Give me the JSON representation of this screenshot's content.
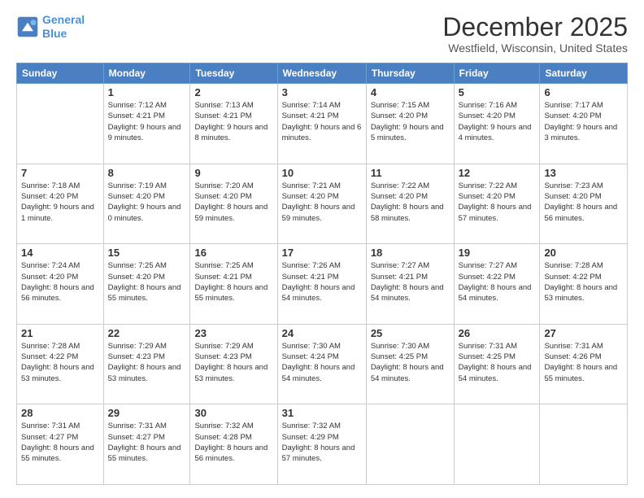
{
  "logo": {
    "line1": "General",
    "line2": "Blue"
  },
  "title": "December 2025",
  "subtitle": "Westfield, Wisconsin, United States",
  "days_header": [
    "Sunday",
    "Monday",
    "Tuesday",
    "Wednesday",
    "Thursday",
    "Friday",
    "Saturday"
  ],
  "weeks": [
    [
      {
        "num": "",
        "info": ""
      },
      {
        "num": "1",
        "info": "Sunrise: 7:12 AM\nSunset: 4:21 PM\nDaylight: 9 hours\nand 9 minutes."
      },
      {
        "num": "2",
        "info": "Sunrise: 7:13 AM\nSunset: 4:21 PM\nDaylight: 9 hours\nand 8 minutes."
      },
      {
        "num": "3",
        "info": "Sunrise: 7:14 AM\nSunset: 4:21 PM\nDaylight: 9 hours\nand 6 minutes."
      },
      {
        "num": "4",
        "info": "Sunrise: 7:15 AM\nSunset: 4:20 PM\nDaylight: 9 hours\nand 5 minutes."
      },
      {
        "num": "5",
        "info": "Sunrise: 7:16 AM\nSunset: 4:20 PM\nDaylight: 9 hours\nand 4 minutes."
      },
      {
        "num": "6",
        "info": "Sunrise: 7:17 AM\nSunset: 4:20 PM\nDaylight: 9 hours\nand 3 minutes."
      }
    ],
    [
      {
        "num": "7",
        "info": "Sunrise: 7:18 AM\nSunset: 4:20 PM\nDaylight: 9 hours\nand 1 minute."
      },
      {
        "num": "8",
        "info": "Sunrise: 7:19 AM\nSunset: 4:20 PM\nDaylight: 9 hours\nand 0 minutes."
      },
      {
        "num": "9",
        "info": "Sunrise: 7:20 AM\nSunset: 4:20 PM\nDaylight: 8 hours\nand 59 minutes."
      },
      {
        "num": "10",
        "info": "Sunrise: 7:21 AM\nSunset: 4:20 PM\nDaylight: 8 hours\nand 59 minutes."
      },
      {
        "num": "11",
        "info": "Sunrise: 7:22 AM\nSunset: 4:20 PM\nDaylight: 8 hours\nand 58 minutes."
      },
      {
        "num": "12",
        "info": "Sunrise: 7:22 AM\nSunset: 4:20 PM\nDaylight: 8 hours\nand 57 minutes."
      },
      {
        "num": "13",
        "info": "Sunrise: 7:23 AM\nSunset: 4:20 PM\nDaylight: 8 hours\nand 56 minutes."
      }
    ],
    [
      {
        "num": "14",
        "info": "Sunrise: 7:24 AM\nSunset: 4:20 PM\nDaylight: 8 hours\nand 56 minutes."
      },
      {
        "num": "15",
        "info": "Sunrise: 7:25 AM\nSunset: 4:20 PM\nDaylight: 8 hours\nand 55 minutes."
      },
      {
        "num": "16",
        "info": "Sunrise: 7:25 AM\nSunset: 4:21 PM\nDaylight: 8 hours\nand 55 minutes."
      },
      {
        "num": "17",
        "info": "Sunrise: 7:26 AM\nSunset: 4:21 PM\nDaylight: 8 hours\nand 54 minutes."
      },
      {
        "num": "18",
        "info": "Sunrise: 7:27 AM\nSunset: 4:21 PM\nDaylight: 8 hours\nand 54 minutes."
      },
      {
        "num": "19",
        "info": "Sunrise: 7:27 AM\nSunset: 4:22 PM\nDaylight: 8 hours\nand 54 minutes."
      },
      {
        "num": "20",
        "info": "Sunrise: 7:28 AM\nSunset: 4:22 PM\nDaylight: 8 hours\nand 53 minutes."
      }
    ],
    [
      {
        "num": "21",
        "info": "Sunrise: 7:28 AM\nSunset: 4:22 PM\nDaylight: 8 hours\nand 53 minutes."
      },
      {
        "num": "22",
        "info": "Sunrise: 7:29 AM\nSunset: 4:23 PM\nDaylight: 8 hours\nand 53 minutes."
      },
      {
        "num": "23",
        "info": "Sunrise: 7:29 AM\nSunset: 4:23 PM\nDaylight: 8 hours\nand 53 minutes."
      },
      {
        "num": "24",
        "info": "Sunrise: 7:30 AM\nSunset: 4:24 PM\nDaylight: 8 hours\nand 54 minutes."
      },
      {
        "num": "25",
        "info": "Sunrise: 7:30 AM\nSunset: 4:25 PM\nDaylight: 8 hours\nand 54 minutes."
      },
      {
        "num": "26",
        "info": "Sunrise: 7:31 AM\nSunset: 4:25 PM\nDaylight: 8 hours\nand 54 minutes."
      },
      {
        "num": "27",
        "info": "Sunrise: 7:31 AM\nSunset: 4:26 PM\nDaylight: 8 hours\nand 55 minutes."
      }
    ],
    [
      {
        "num": "28",
        "info": "Sunrise: 7:31 AM\nSunset: 4:27 PM\nDaylight: 8 hours\nand 55 minutes."
      },
      {
        "num": "29",
        "info": "Sunrise: 7:31 AM\nSunset: 4:27 PM\nDaylight: 8 hours\nand 55 minutes."
      },
      {
        "num": "30",
        "info": "Sunrise: 7:32 AM\nSunset: 4:28 PM\nDaylight: 8 hours\nand 56 minutes."
      },
      {
        "num": "31",
        "info": "Sunrise: 7:32 AM\nSunset: 4:29 PM\nDaylight: 8 hours\nand 57 minutes."
      },
      {
        "num": "",
        "info": ""
      },
      {
        "num": "",
        "info": ""
      },
      {
        "num": "",
        "info": ""
      }
    ]
  ]
}
